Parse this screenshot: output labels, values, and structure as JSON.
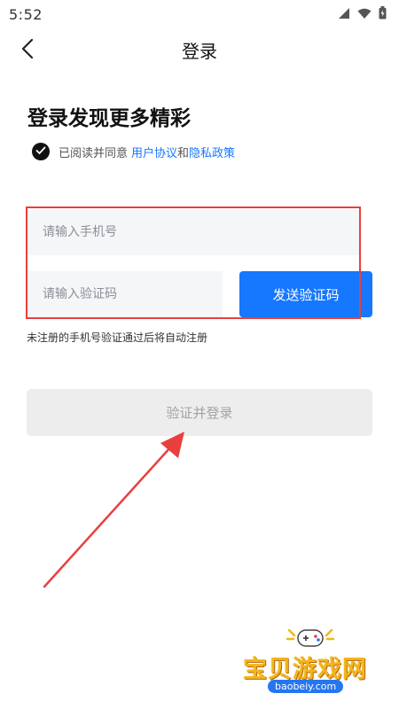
{
  "status_bar": {
    "time": "5:52",
    "icons": [
      "signal-icon",
      "wifi-icon",
      "battery-icon"
    ]
  },
  "nav": {
    "back_icon": "chevron-left-icon",
    "title": "登录"
  },
  "headline": "登录发现更多精彩",
  "agreement": {
    "checked": true,
    "prefix": "已阅读并同意",
    "user_agreement": "用户协议",
    "and": "和",
    "privacy_policy": "隐私政策"
  },
  "form": {
    "phone_placeholder": "请输入手机号",
    "code_placeholder": "请输入验证码",
    "send_code_label": "发送验证码",
    "hint": "未注册的手机号验证通过后将自动注册",
    "login_label": "验证并登录"
  },
  "watermark": {
    "title": "宝贝游戏网",
    "url": "baobeiy.com"
  },
  "colors": {
    "accent": "#1677ff",
    "annotation": "#e8403f",
    "disabled_bg": "#ededed",
    "disabled_text": "#a3a3a3",
    "input_bg": "#f5f6f8"
  }
}
